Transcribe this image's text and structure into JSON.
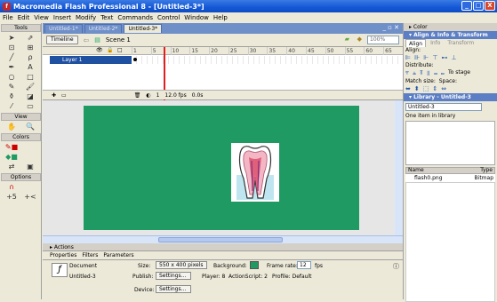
{
  "window": {
    "title": "Macromedia Flash Professional 8 - [Untitled-3*]",
    "min": "_",
    "max": "□",
    "close": "X"
  },
  "menu": [
    "File",
    "Edit",
    "View",
    "Insert",
    "Modify",
    "Text",
    "Commands",
    "Control",
    "Window",
    "Help"
  ],
  "tools": {
    "title": "Tools",
    "view_title": "View",
    "colors_title": "Colors",
    "options_title": "Options"
  },
  "doc_tabs": [
    "Untitled-1*",
    "Untitled-2*",
    "Untitled-3*"
  ],
  "editbar": {
    "timeline_label": "Timeline",
    "scene_label": "Scene 1",
    "zoom": "100%"
  },
  "timeline": {
    "layer_name": "Layer 1",
    "ruler": [
      "1",
      "5",
      "10",
      "15",
      "20",
      "25",
      "30",
      "35",
      "40",
      "45",
      "50",
      "55",
      "60",
      "65"
    ],
    "current_frame": "1",
    "fps": "12.0 fps",
    "time": "0.0s"
  },
  "actions_title": "Actions",
  "property_tabs": [
    "Properties",
    "Filters",
    "Parameters"
  ],
  "properties": {
    "type": "Document",
    "name": "Untitled-3",
    "size_label": "Size:",
    "size_value": "550 x 400 pixels",
    "background_label": "Background:",
    "background_color": "#1f9a62",
    "frame_rate_label": "Frame rate:",
    "frame_rate": "12",
    "fps_unit": "fps",
    "publish_label": "Publish:",
    "publish_button": "Settings...",
    "player": "Player: 8",
    "actionscript": "ActionScript: 2",
    "profile": "Profile: Default",
    "device_label": "Device:",
    "device_button": "Settings..."
  },
  "right": {
    "color_panel": "Color",
    "align_panel": "Align & Info & Transform",
    "align_tabs": [
      "Align",
      "Info",
      "Transform"
    ],
    "align_label": "Align:",
    "distribute_label": "Distribute:",
    "match_label": "Match size:",
    "space_label": "Space:",
    "to_stage": "To stage",
    "library_panel": "Library - Untitled-3",
    "library_select": "Untitled-3",
    "library_count": "One item in library",
    "col_name": "Name",
    "col_type": "Type",
    "item_name": "flash0.png",
    "item_type": "Bitmap"
  },
  "colors": {
    "accent": "#1457d6",
    "stage": "#1f9a62"
  }
}
